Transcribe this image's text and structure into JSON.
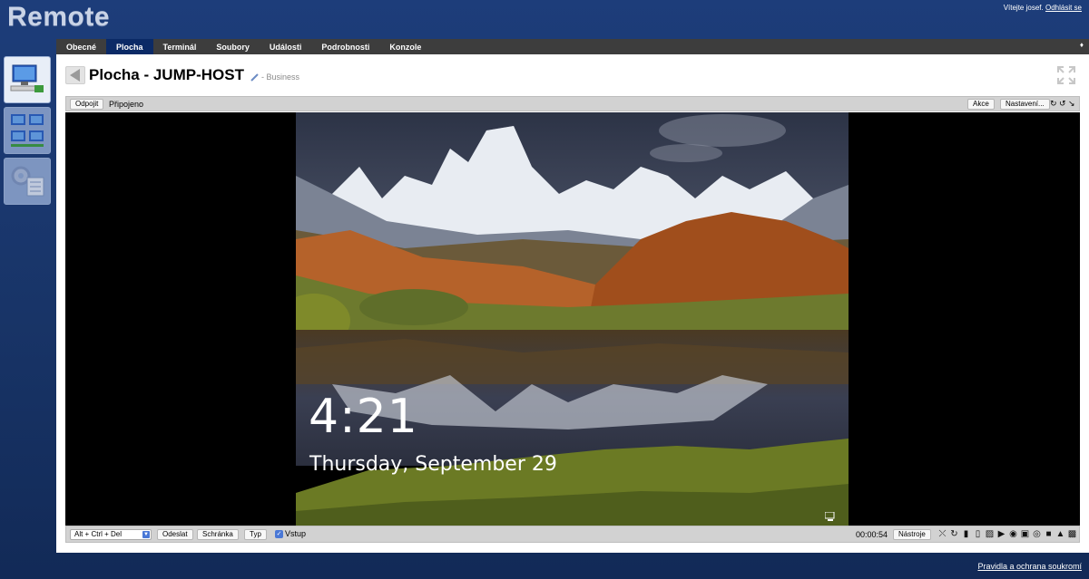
{
  "app": {
    "title": "Remote"
  },
  "header": {
    "welcome": "Vítejte josef.",
    "logout": "Odhlásit se"
  },
  "tabs": [
    {
      "label": "Obecné",
      "active": false
    },
    {
      "label": "Plocha",
      "active": true
    },
    {
      "label": "Terminál",
      "active": false
    },
    {
      "label": "Soubory",
      "active": false
    },
    {
      "label": "Události",
      "active": false
    },
    {
      "label": "Podrobnosti",
      "active": false
    },
    {
      "label": "Konzole",
      "active": false
    }
  ],
  "page": {
    "title": "Plocha - JUMP-HOST",
    "subtitle": "- Business"
  },
  "toolbar": {
    "disconnect": "Odpojit",
    "status": "Připojeno",
    "actions": "Akce",
    "settings": "Nastavení..."
  },
  "remote": {
    "time": "4:21",
    "date": "Thursday, September 29"
  },
  "bottom": {
    "key_combo": "Alt + Ctrl + Del",
    "send": "Odeslat",
    "clipboard": "Schránka",
    "type": "Typ",
    "input": "Vstup",
    "timer": "00:00:54",
    "tools": "Nástroje"
  },
  "footer": {
    "link": "Pravidla a ochrana soukromí"
  },
  "colors": {
    "accent": "#0b2a66",
    "tabbar": "#3d3d3d",
    "background": "#1d3d7a"
  }
}
